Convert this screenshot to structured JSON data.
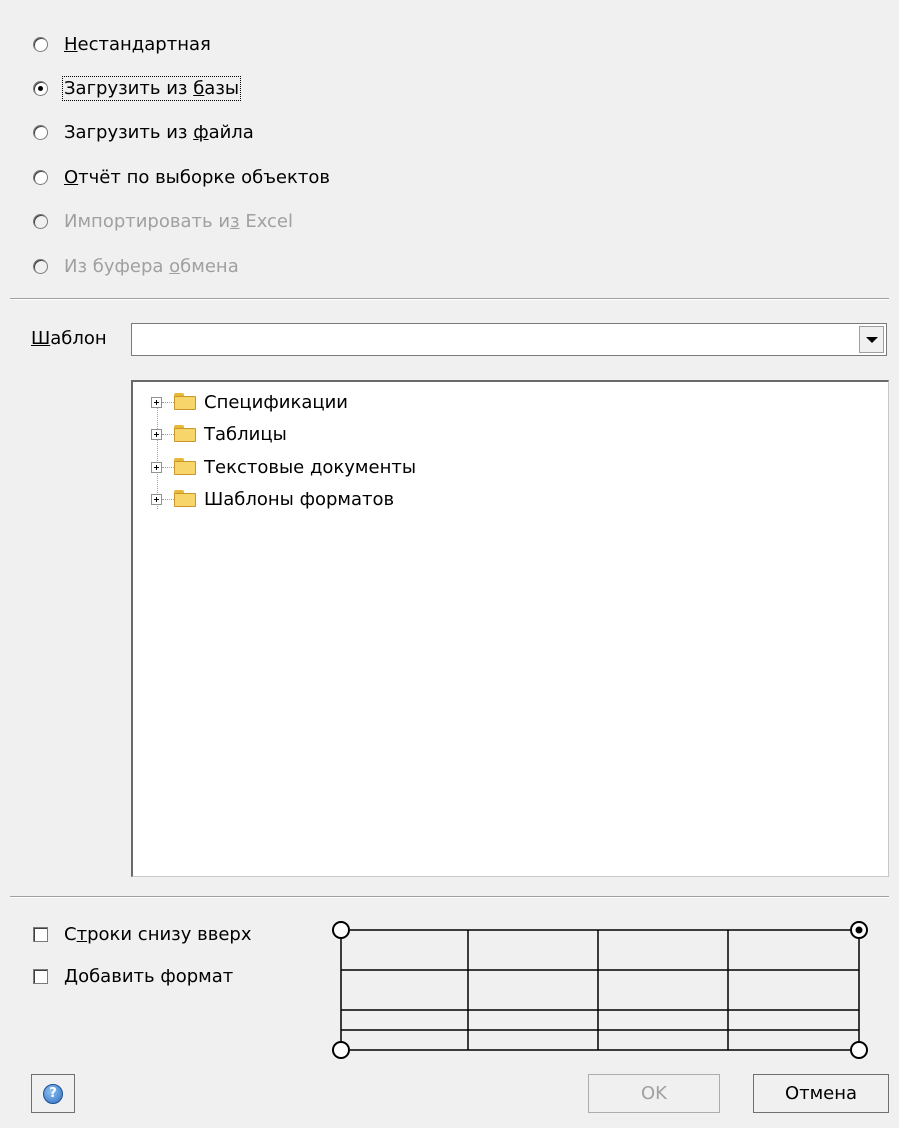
{
  "source_options": [
    {
      "label_u": "Н",
      "label_rest": "естандартная",
      "checked": false,
      "disabled": false
    },
    {
      "label_pre": "Загрузить из ",
      "label_u": "б",
      "label_rest": "азы",
      "checked": true,
      "disabled": false
    },
    {
      "label_pre": "Загрузить из ",
      "label_u": "ф",
      "label_rest": "айла",
      "checked": false,
      "disabled": false
    },
    {
      "label_u": "О",
      "label_rest": "тчёт по выборке объектов",
      "checked": false,
      "disabled": false
    },
    {
      "label_pre": "Импортировать и",
      "label_u": "з",
      "label_rest": " Excel",
      "checked": false,
      "disabled": true
    },
    {
      "label_pre": "Из буфера ",
      "label_u": "о",
      "label_rest": "бмена",
      "checked": false,
      "disabled": true
    }
  ],
  "template": {
    "label_u": "Ш",
    "label_rest": "аблон",
    "value": ""
  },
  "tree": {
    "items": [
      {
        "label": "Спецификации"
      },
      {
        "label": "Таблицы"
      },
      {
        "label": "Текстовые документы"
      },
      {
        "label": "Шаблоны форматов"
      }
    ]
  },
  "options": {
    "rows_bottom_up": {
      "label_pre": "С",
      "label_u": "т",
      "label_rest": "роки снизу вверх",
      "checked": false
    },
    "add_format": {
      "label_u": "Д",
      "label_rest": "обавить формат",
      "checked": false
    }
  },
  "origin_diagram": {
    "selected_corner": "top-right"
  },
  "buttons": {
    "ok": "OK",
    "cancel": "Отмена",
    "help": "?"
  }
}
